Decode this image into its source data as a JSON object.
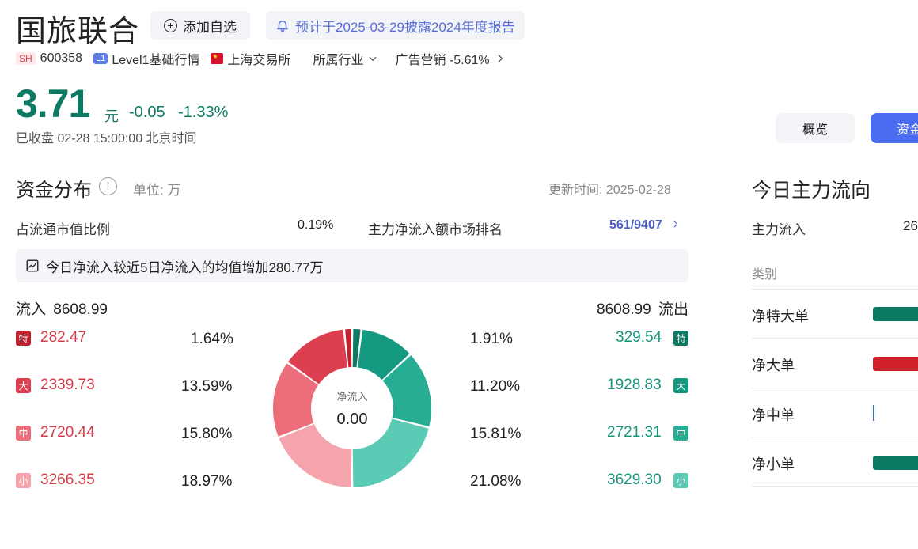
{
  "header": {
    "stock_name": "国旅联合",
    "add_button_label": "添加自选",
    "notice": "预计于2025-03-29披露2024年度报告"
  },
  "meta": {
    "exchange_tag": "SH",
    "code": "600358",
    "level_tag": "L1",
    "level_label": "Level1基础行情",
    "market": "上海交易所",
    "industry_label": "所属行业",
    "industry_value": "广告营销 -5.61%"
  },
  "quote": {
    "price": "3.71",
    "unit": "元",
    "change": "-0.05",
    "change_pct": "-1.33%",
    "status": "已收盘 02-28 15:00:00 北京时间"
  },
  "tabs": {
    "overview": "概览",
    "fund": "资金"
  },
  "fund_distribution": {
    "title": "资金分布",
    "info_icon": "!",
    "unit": "单位: 万",
    "update_time": "更新时间: 2025-02-28",
    "ratio_label": "占流通市值比例",
    "ratio_value": "0.19%",
    "rank_label": "主力净流入额市场排名",
    "rank_value": "561/9407",
    "tip": "今日净流入较近5日净流入的均值增加280.77万",
    "inflow_label": "流入",
    "inflow_total": "8608.99",
    "outflow_total": "8608.99",
    "outflow_label": "流出",
    "center_label": "净流入",
    "center_value": "0.00",
    "inflow_rows": [
      {
        "badge": "特",
        "value": "282.47",
        "pct": "1.64%",
        "color": "#c0222f"
      },
      {
        "badge": "大",
        "value": "2339.73",
        "pct": "13.59%",
        "color": "#dc3f4f"
      },
      {
        "badge": "中",
        "value": "2720.44",
        "pct": "15.80%",
        "color": "#ec6e7b"
      },
      {
        "badge": "小",
        "value": "3266.35",
        "pct": "18.97%",
        "color": "#f5a3ac"
      }
    ],
    "outflow_rows": [
      {
        "badge": "特",
        "value": "329.54",
        "pct": "1.91%",
        "color": "#0f7a64"
      },
      {
        "badge": "大",
        "value": "1928.83",
        "pct": "11.20%",
        "color": "#139a80"
      },
      {
        "badge": "中",
        "value": "2721.31",
        "pct": "15.81%",
        "color": "#26ad94"
      },
      {
        "badge": "小",
        "value": "3629.30",
        "pct": "21.08%",
        "color": "#5ccbb6"
      }
    ]
  },
  "main_flow": {
    "title": "今日主力流向",
    "main_inflow_label": "主力流入",
    "main_inflow_value": "26",
    "category_label": "类别",
    "rows": [
      {
        "label": "净特大单",
        "bar_color": "#0c7a63",
        "level": 1
      },
      {
        "label": "净大单",
        "bar_color": "#d0202c",
        "level": 1
      },
      {
        "label": "净中单",
        "bar_color": "#4a6fa8",
        "level": 0.02
      },
      {
        "label": "净小单",
        "bar_color": "#0c7a63",
        "level": 1
      }
    ]
  }
}
